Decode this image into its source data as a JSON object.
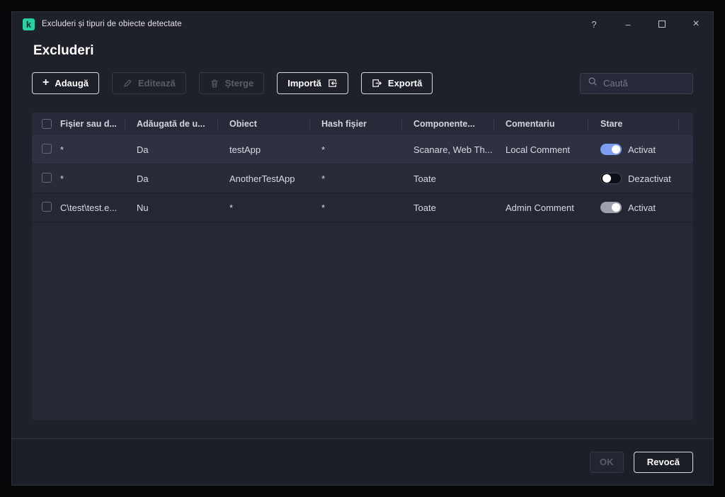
{
  "window": {
    "title": "Excluderi și tipuri de obiecte detectate",
    "controls": {
      "help": "?",
      "minimize": "–",
      "close": "×"
    }
  },
  "page": {
    "title": "Excluderi"
  },
  "toolbar": {
    "add_label": "Adaugă",
    "edit_label": "Editează",
    "delete_label": "Șterge",
    "import_label": "Importă",
    "export_label": "Exportă",
    "search_placeholder": "Caută"
  },
  "table": {
    "columns": [
      "Fișier sau d...",
      "Adăugată de u...",
      "Obiect",
      "Hash fișier",
      "Componente...",
      "Comentariu",
      "Stare"
    ],
    "rows": [
      {
        "file": "*",
        "added_by": "Da",
        "object": "testApp",
        "hash": "*",
        "components": "Scanare, Web Th...",
        "comment": "Local Comment",
        "state": "on",
        "state_label": "Activat",
        "selected": true
      },
      {
        "file": "*",
        "added_by": "Da",
        "object": "AnotherTestApp",
        "hash": "*",
        "components": "Toate",
        "comment": "",
        "state": "off",
        "state_label": "Dezactivat",
        "selected": false
      },
      {
        "file": "C\\test\\test.e...",
        "added_by": "Nu",
        "object": "*",
        "hash": "*",
        "components": "Toate",
        "comment": "Admin Comment",
        "state": "on-disabled",
        "state_label": "Activat",
        "selected": false
      }
    ]
  },
  "footer": {
    "ok_label": "OK",
    "cancel_label": "Revocă"
  },
  "colors": {
    "brand_green": "#26d1a4",
    "toggle_on_blue": "#7b9ef0",
    "selected_row": "#2e3142"
  }
}
